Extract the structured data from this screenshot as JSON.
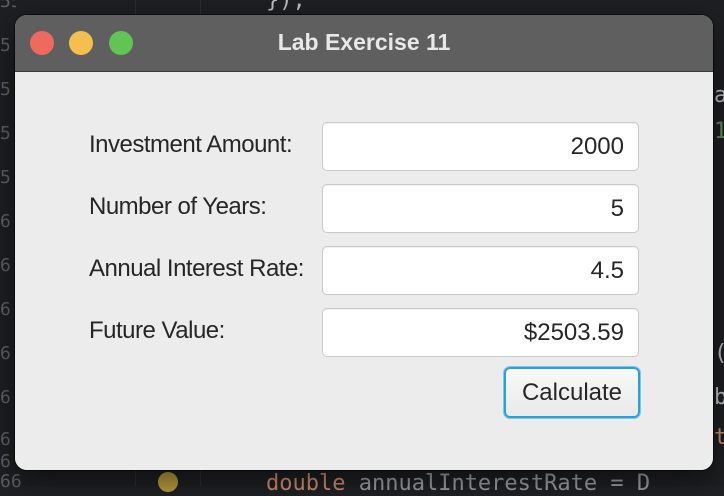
{
  "editor": {
    "gutter_numbers": [
      "55",
      "5",
      "5",
      "5",
      "5",
      "6",
      "6",
      "6",
      "6",
      "6",
      "6",
      "6",
      "66"
    ],
    "code_top": "});",
    "code_bottom_keyword": "double",
    "code_bottom_rest": " annualInterestRate = D",
    "right_fragments": [
      "a",
      "1",
      "(",
      "b",
      "t"
    ]
  },
  "window": {
    "title": "Lab Exercise 11"
  },
  "form": {
    "investment_label": "Investment Amount:",
    "investment_value": "2000",
    "years_label": "Number of Years:",
    "years_value": "5",
    "rate_label": "Annual Interest Rate:",
    "rate_value": "4.5",
    "future_label": "Future Value:",
    "future_value": "$2503.59",
    "calculate_label": "Calculate"
  },
  "colors": {
    "close": "#ed6a5e",
    "minimize": "#f5bf4f",
    "zoom": "#61c554",
    "focus_ring": "#2aa0d8"
  }
}
